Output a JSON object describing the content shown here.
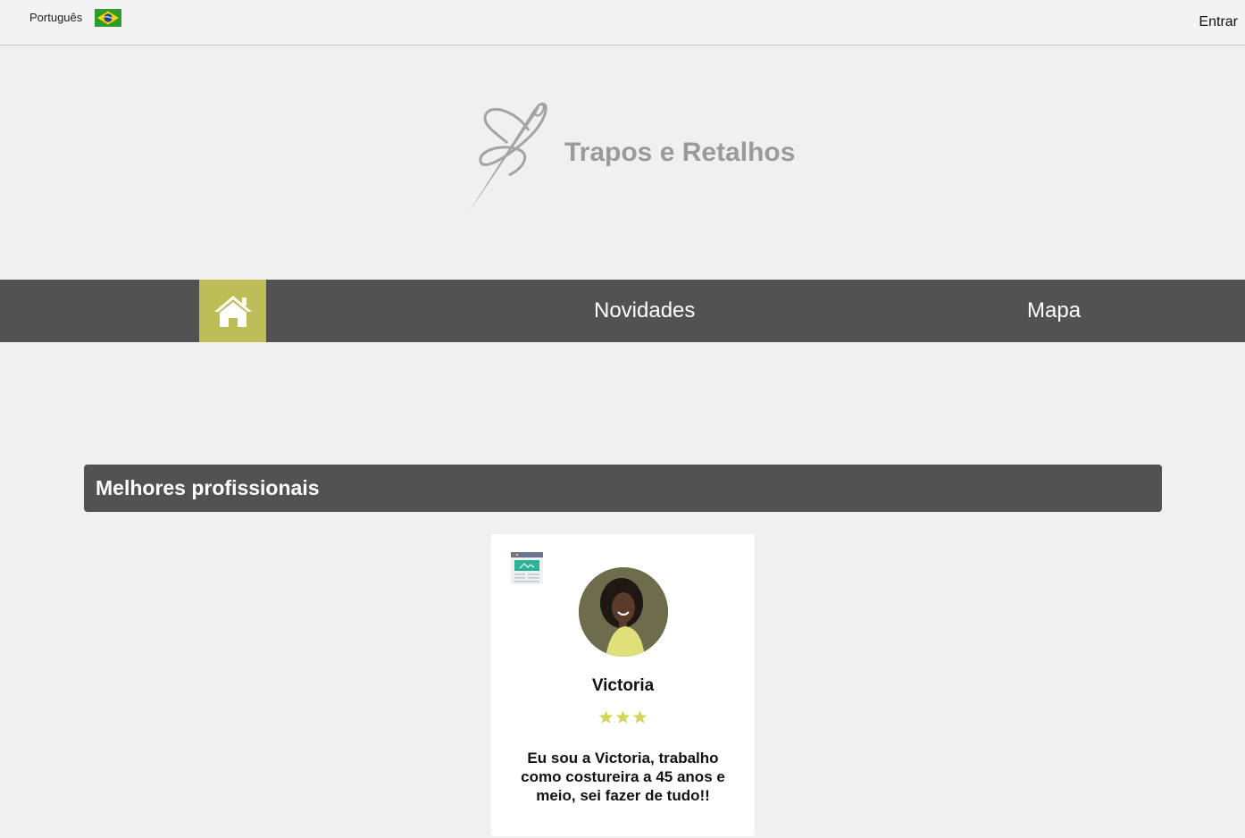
{
  "topbar": {
    "language_label": "Português",
    "flag_icon": "brazil-flag-icon",
    "login_label": "Entrar"
  },
  "hero": {
    "logo_icon": "needle-thread-logo",
    "site_title": "Trapos e Retalhos"
  },
  "nav": {
    "home_icon": "home-icon",
    "items": [
      {
        "label": "Novidades"
      },
      {
        "label": "Mapa"
      }
    ]
  },
  "section": {
    "title": "Melhores profissionais"
  },
  "professionals": [
    {
      "name": "Victoria",
      "rating": 3,
      "description": "Eu sou a Victoria, trabalho como costureira a 45 anos e meio, sei fazer de tudo!!",
      "site_icon": "website-icon",
      "avatar_icon": "profile-photo"
    }
  ],
  "colors": {
    "nav_background": "#525252",
    "accent": "#bcbd57",
    "star": "#d4d45a",
    "title_gray": "#9a9a9a"
  }
}
